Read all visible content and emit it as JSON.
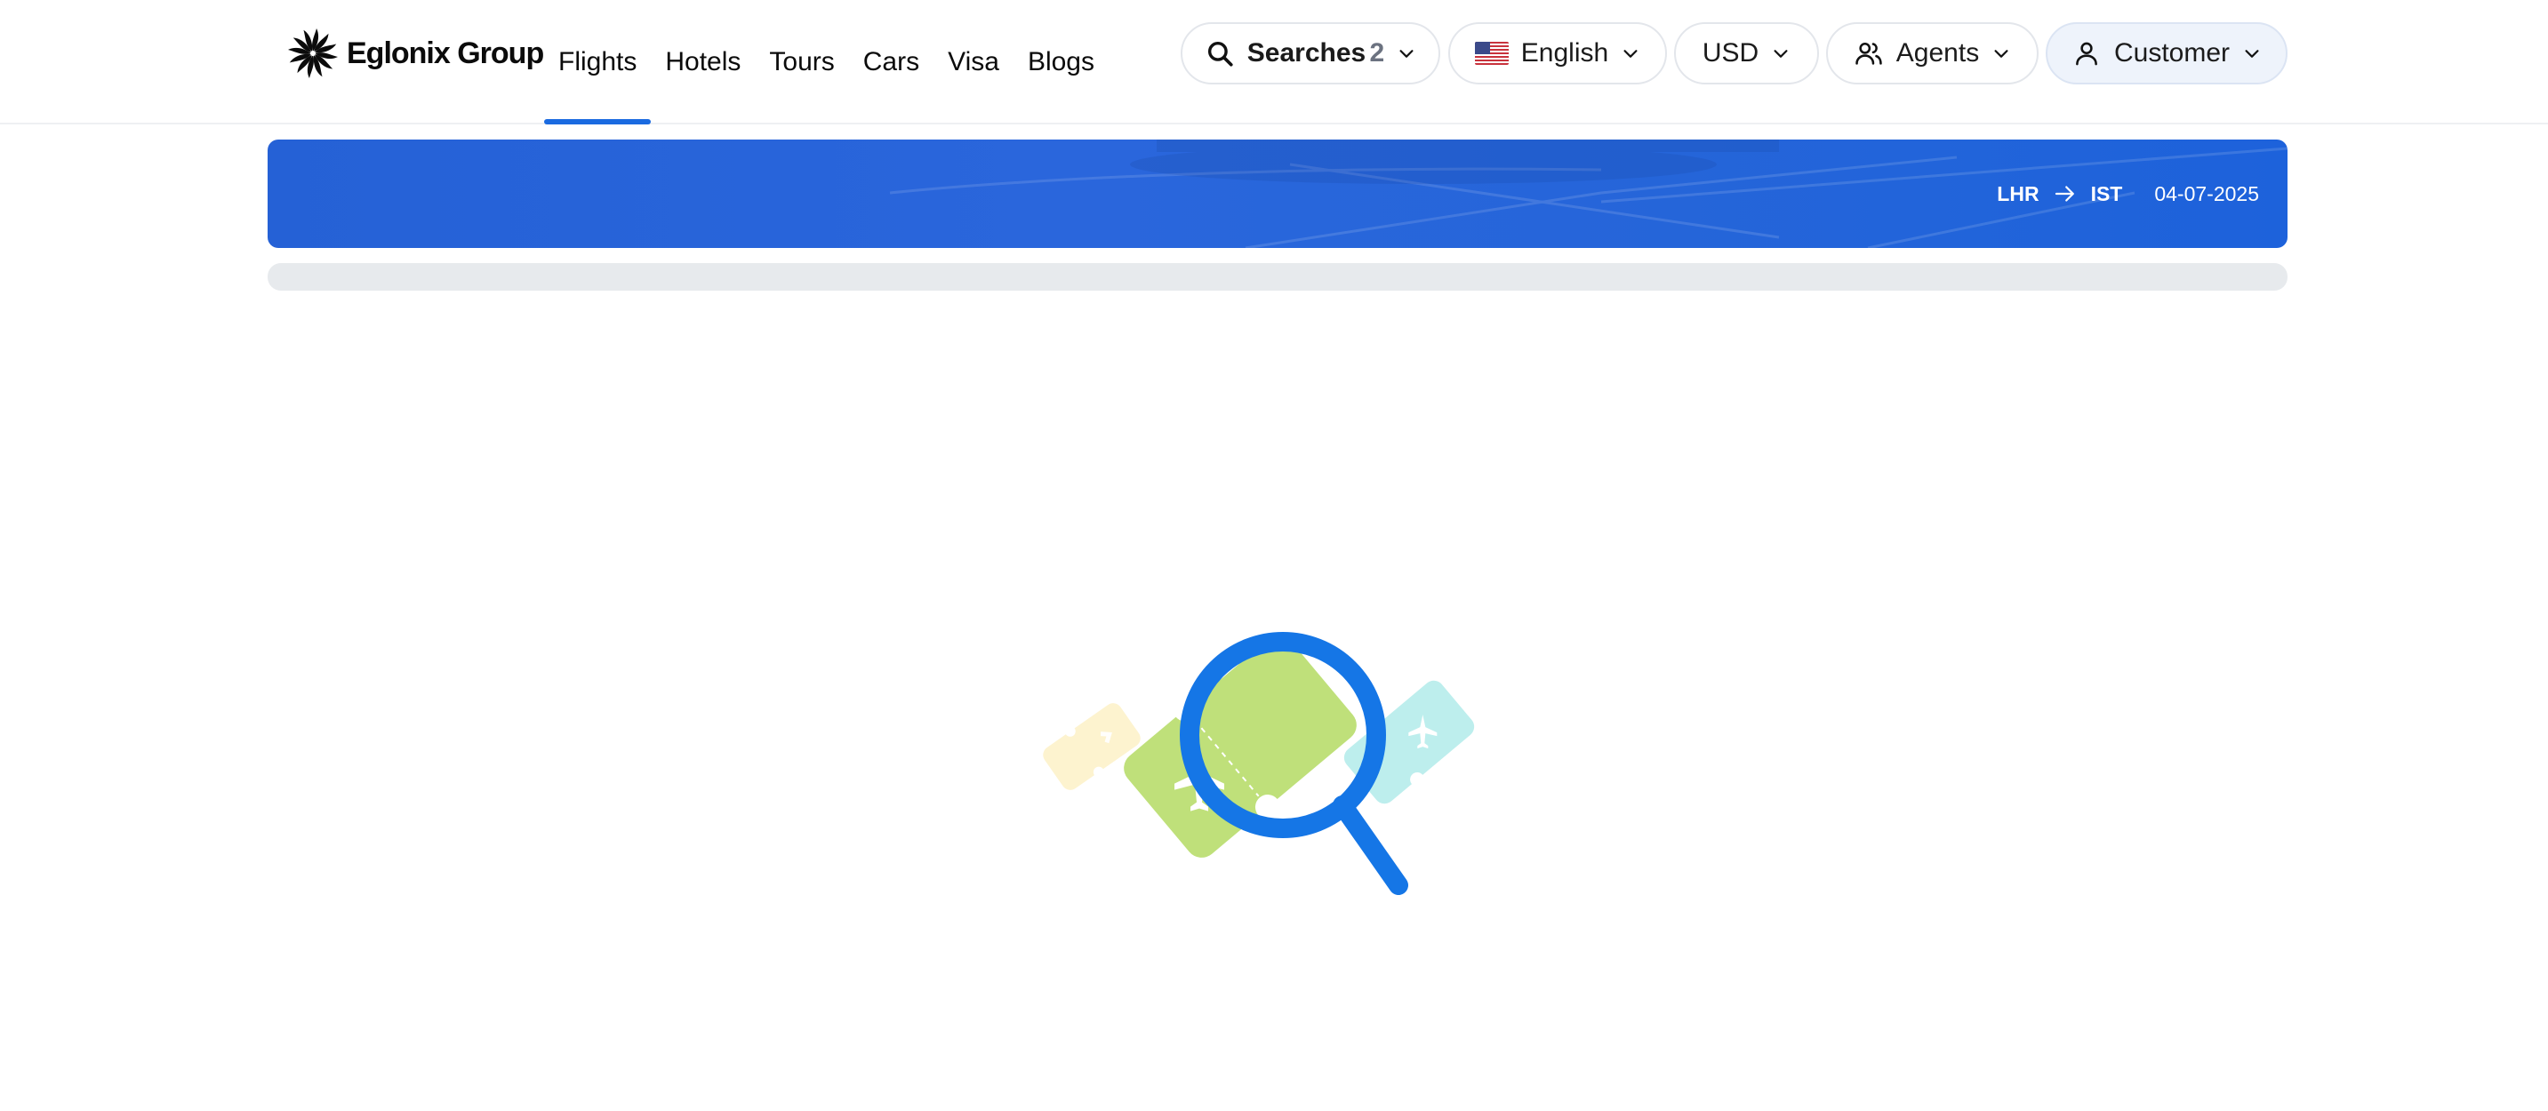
{
  "brand": {
    "name": "Eglonix Group",
    "logo_icon": "starburst-logo-icon"
  },
  "nav": {
    "items": [
      {
        "label": "Flights",
        "active": true
      },
      {
        "label": "Hotels",
        "active": false
      },
      {
        "label": "Tours",
        "active": false
      },
      {
        "label": "Cars",
        "active": false
      },
      {
        "label": "Visa",
        "active": false
      },
      {
        "label": "Blogs",
        "active": false
      }
    ]
  },
  "toolbar": {
    "searches_label": "Searches",
    "searches_count": "2",
    "language_label": "English",
    "language_flag": "us-flag-icon",
    "currency_label": "USD",
    "agents_label": "Agents",
    "customer_label": "Customer"
  },
  "banner": {
    "origin": "LHR",
    "destination": "IST",
    "date": "04-07-2025"
  },
  "loading": {
    "illustration": "magnifier-flight-tickets-illustration"
  },
  "colors": {
    "accent": "#1a6ae0",
    "banner": "#2563da",
    "track": "#e7eaed",
    "ticket_green": "#bfe07a",
    "ticket_cyan": "#bdeeed",
    "ticket_yellow": "#fdf3cf",
    "magnifier": "#2b8ff0"
  }
}
